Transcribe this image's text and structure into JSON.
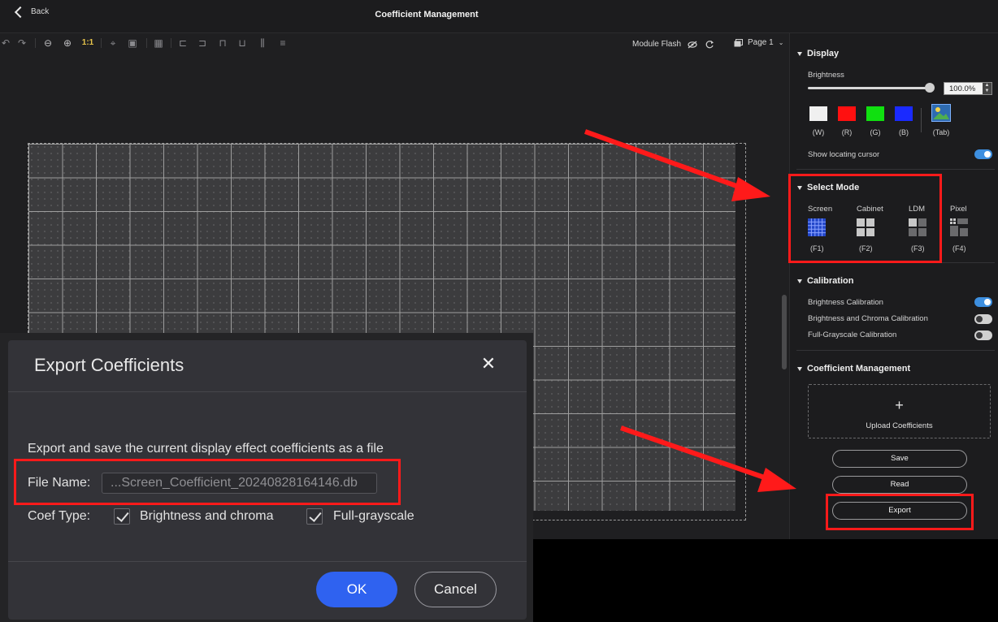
{
  "header": {
    "back_label": "Back",
    "title": "Coefficient Management"
  },
  "toolbar": {
    "zoom_1to1": "1:1",
    "module_flash": "Module Flash",
    "page_label": "Page 1",
    "icons": [
      "undo-icon",
      "redo-icon",
      "zoom-out-icon",
      "zoom-in-icon",
      "fit-icon",
      "select-region-icon",
      "grid-icon",
      "align-left-icon",
      "align-center-icon",
      "align-top-icon",
      "align-middle-icon",
      "distribute-h-icon",
      "distribute-v-icon"
    ]
  },
  "display": {
    "heading": "Display",
    "brightness_label": "Brightness",
    "brightness_value": "100.0%",
    "brightness_fraction": 1.0,
    "colors": [
      {
        "key": "(W)",
        "color": "#f0f0f0"
      },
      {
        "key": "(R)",
        "color": "#ff1010"
      },
      {
        "key": "(G)",
        "color": "#10e010"
      },
      {
        "key": "(B)",
        "color": "#1a2aff"
      },
      {
        "key": "(Tab)",
        "color": "#2e6bb0"
      }
    ],
    "show_cursor_label": "Show locating cursor",
    "show_cursor_on": true
  },
  "select_mode": {
    "heading": "Select Mode",
    "modes": [
      {
        "name": "Screen",
        "key": "(F1)",
        "selected": true
      },
      {
        "name": "Cabinet",
        "key": "(F2)",
        "selected": false
      },
      {
        "name": "LDM",
        "key": "(F3)",
        "selected": false
      },
      {
        "name": "Pixel",
        "key": "(F4)",
        "selected": false
      }
    ]
  },
  "calibration": {
    "heading": "Calibration",
    "items": [
      {
        "label": "Brightness Calibration",
        "on": true
      },
      {
        "label": "Brightness and Chroma Calibration",
        "on": false
      },
      {
        "label": "Full-Grayscale Calibration",
        "on": false
      }
    ]
  },
  "coef_mgmt": {
    "heading": "Coefficient Management",
    "upload_plus": "+",
    "upload_label": "Upload Coefficients",
    "save_label": "Save",
    "read_label": "Read",
    "export_label": "Export"
  },
  "dialog": {
    "title": "Export Coefficients",
    "close": "✕",
    "description": "Export and save the current display effect coefficients as a file",
    "file_name_label": "File Name:",
    "file_name_value": "...Screen_Coefficient_20240828164146.db",
    "coef_type_label": "Coef Type:",
    "opt_brightness_chroma": "Brightness and chroma",
    "opt_full_grayscale": "Full-grayscale",
    "ok_label": "OK",
    "cancel_label": "Cancel"
  },
  "colors": {
    "accent": "#2f62f0",
    "toggle_on": "#3d8fe0",
    "annotation": "#ff1a1a"
  }
}
